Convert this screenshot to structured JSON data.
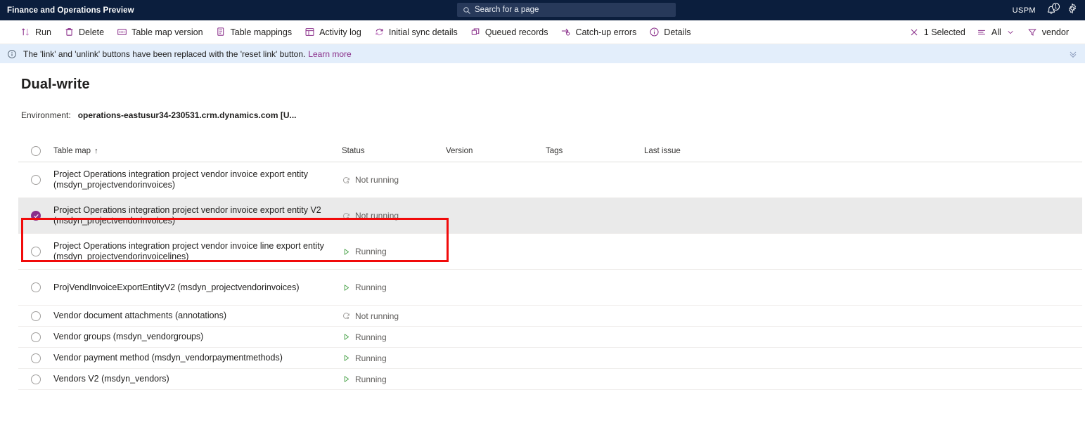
{
  "topbar": {
    "title": "Finance and Operations Preview",
    "search_placeholder": "Search for a page",
    "search_icon": "search-icon",
    "user": "USPM",
    "notification_icon": "bell-icon",
    "notification_count": "1",
    "settings_icon": "gear-icon"
  },
  "toolbar": {
    "items": [
      {
        "label": "Run",
        "icon": "sort-arrows-icon"
      },
      {
        "label": "Delete",
        "icon": "trash-icon"
      },
      {
        "label": "Table map version",
        "icon": "table-version-icon"
      },
      {
        "label": "Table mappings",
        "icon": "table-mappings-icon"
      },
      {
        "label": "Activity log",
        "icon": "activity-log-icon"
      },
      {
        "label": "Initial sync details",
        "icon": "sync-refresh-icon"
      },
      {
        "label": "Queued records",
        "icon": "queued-records-icon"
      },
      {
        "label": "Catch-up errors",
        "icon": "catch-up-errors-icon"
      },
      {
        "label": "Details",
        "icon": "info-circle-icon"
      }
    ],
    "right_items": [
      {
        "label": "1 Selected",
        "icon": "close-x-icon"
      },
      {
        "label": "All",
        "icon": "list-lines-icon",
        "chevron": "chevron-down-icon"
      },
      {
        "label": "vendor",
        "icon": "filter-funnel-icon"
      }
    ]
  },
  "infobar": {
    "icon": "info-circle-icon",
    "text": "The 'link' and 'unlink' buttons have been replaced with the 'reset link' button.",
    "link_label": "Learn more",
    "collapse_icon": "chevron-double-down-icon"
  },
  "page": {
    "title": "Dual-write",
    "environment_label": "Environment:",
    "environment_value": "operations-eastusur34-230531.crm.dynamics.com [U..."
  },
  "grid": {
    "columns": {
      "table_map": "Table map",
      "sort_indicator": "↑",
      "status": "Status",
      "version": "Version",
      "tags": "Tags",
      "last_issue": "Last issue"
    },
    "rows": [
      {
        "name": "Project Operations integration project vendor invoice export entity (msdyn_projectvendorinvoices)",
        "status": "Not running",
        "status_icon": "not-running-icon",
        "version": "",
        "tags": "",
        "last_issue": "",
        "selected": false,
        "tall": true
      },
      {
        "name": "Project Operations integration project vendor invoice export entity V2 (msdyn_projectvendorinvoices)",
        "status": "Not running",
        "status_icon": "not-running-icon",
        "version": "",
        "tags": "",
        "last_issue": "",
        "selected": true,
        "tall": true
      },
      {
        "name": "Project Operations integration project vendor invoice line export entity (msdyn_projectvendorinvoicelines)",
        "status": "Running",
        "status_icon": "running-icon",
        "version": "",
        "tags": "",
        "last_issue": "",
        "selected": false,
        "tall": true
      },
      {
        "name": "ProjVendInvoiceExportEntityV2 (msdyn_projectvendorinvoices)",
        "status": "Running",
        "status_icon": "running-icon",
        "version": "",
        "tags": "",
        "last_issue": "",
        "selected": false,
        "tall": true
      },
      {
        "name": "Vendor document attachments (annotations)",
        "status": "Not running",
        "status_icon": "not-running-icon",
        "version": "",
        "tags": "",
        "last_issue": "",
        "selected": false,
        "tall": false
      },
      {
        "name": "Vendor groups (msdyn_vendorgroups)",
        "status": "Running",
        "status_icon": "running-icon",
        "version": "",
        "tags": "",
        "last_issue": "",
        "selected": false,
        "tall": false
      },
      {
        "name": "Vendor payment method (msdyn_vendorpaymentmethods)",
        "status": "Running",
        "status_icon": "running-icon",
        "version": "",
        "tags": "",
        "last_issue": "",
        "selected": false,
        "tall": false
      },
      {
        "name": "Vendors V2 (msdyn_vendors)",
        "status": "Running",
        "status_icon": "running-icon",
        "version": "",
        "tags": "",
        "last_issue": "",
        "selected": false,
        "tall": false
      }
    ]
  },
  "colors": {
    "topbar_bg": "#0b1e3d",
    "accent_purple": "#8a2f8a",
    "info_bg": "#e3eefb",
    "selected_row_bg": "#eaeaea",
    "running_green": "#4aa34a",
    "annotation_red": "#f10b0b"
  }
}
